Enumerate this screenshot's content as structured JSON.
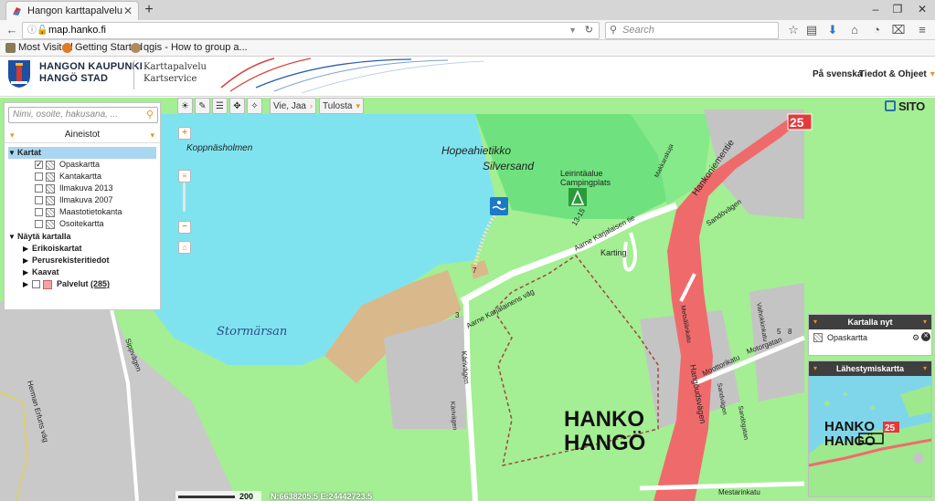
{
  "browser": {
    "tab_title": "Hangon karttapalvelu",
    "url_host": "map.hanko.fi",
    "search_placeholder": "Search",
    "bookmarks": [
      "Most Visited",
      "Getting Started",
      "qgis - How to group a..."
    ]
  },
  "header": {
    "municipality_fi": "HANGON KAUPUNKI",
    "municipality_sv": "HANGÖ STAD",
    "service_fi": "Karttapalvelu",
    "service_sv": "Kartservice",
    "lang_link": "På svenska",
    "info_link": "Tiedot & Ohjeet"
  },
  "toolbar": {
    "share_label": "Vie, Jaa",
    "print_label": "Tulosta",
    "icons": [
      "sun-icon",
      "ruler-icon",
      "list-icon",
      "pan-icon",
      "compass-icon"
    ],
    "logo_text": "SITO"
  },
  "left_panel": {
    "search_placeholder": "Nimi, osoite, hakusana, ...",
    "section_title": "Aineistot",
    "groups": {
      "kartat": "Kartat",
      "nayta": "Näytä kartalla"
    },
    "layers": [
      {
        "label": "Opaskartta",
        "checked": true
      },
      {
        "label": "Kantakartta",
        "checked": false
      },
      {
        "label": "Ilmakuva 2013",
        "checked": false
      },
      {
        "label": "Ilmakuva 2007",
        "checked": false
      },
      {
        "label": "Maastotietokanta",
        "checked": false
      },
      {
        "label": "Osoitekartta",
        "checked": false
      }
    ],
    "subgroups": [
      "Erikoiskartat",
      "Perusrekisteritiedot",
      "Kaavat"
    ],
    "services_label": "Palvelut",
    "services_count": "(285)"
  },
  "map_labels": {
    "koppnas": "Koppnäsholmen",
    "hopea1": "Hopeahietikko",
    "hopea2": "Silversand",
    "camp1": "Leirintäalue",
    "camp2": "Campingplats",
    "karting": "Karting",
    "stormarsan": "Stormärsan",
    "hanko": "HANKO",
    "hango": "HANGÖ",
    "road_num": "25",
    "road_range": "13-15",
    "street1": "Aarne Karjalaisen tie",
    "street2": "Aarne Karjalainens väg",
    "street3": "Hankoniementie",
    "street4": "Hangöudsvägen",
    "street5": "Sandövägen",
    "street6": "Moottorikatu",
    "street7": "Motorgatan",
    "street8": "Mestarinkatu",
    "street9": "Kärivägen",
    "street10": "Valhokkinkatu",
    "street11": "Herman Erfurts väg",
    "street12": "Sippvägen",
    "street13": "Sandvägen",
    "street14": "Metsälänkatu",
    "street15": "Makkarakuja",
    "street16": "Sandögatan",
    "street17": "Kärivägen",
    "num3": "3",
    "num7": "7",
    "num5": "5",
    "num8": "8"
  },
  "right_panels": {
    "now_title": "Kartalla nyt",
    "now_layer": "Opaskartta",
    "overview_title": "Lähestymiskartta",
    "overview_hanko": "HANKO",
    "overview_hango": "HANGÖ",
    "overview_road": "25"
  },
  "footer": {
    "scale_label": "200 m",
    "coordinates": "N:6638205.5 E:24442723.5"
  }
}
